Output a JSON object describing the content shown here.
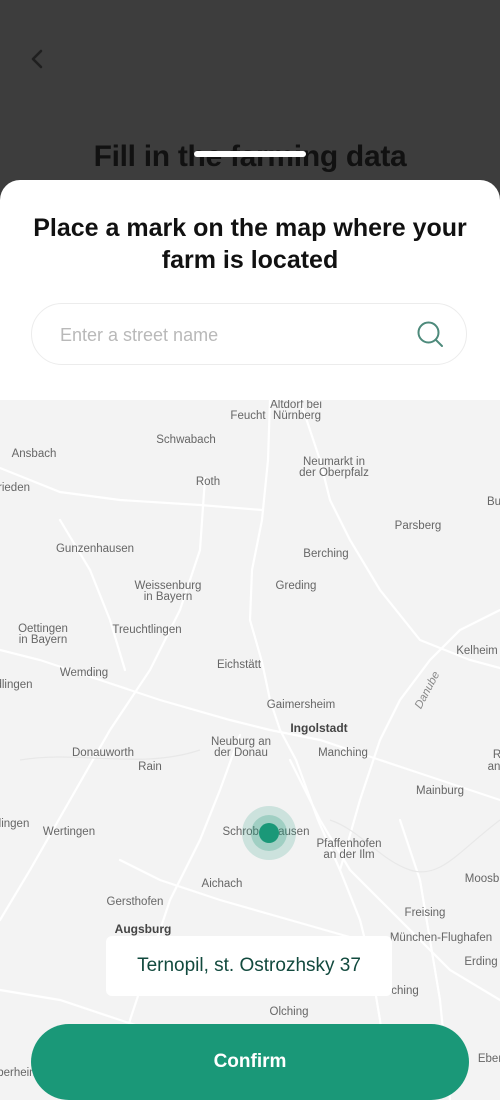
{
  "background": {
    "title": "Fill in the farming data"
  },
  "sheet": {
    "title": "Place a mark on the map where your farm is located",
    "search": {
      "placeholder": "Enter a street name",
      "value": ""
    }
  },
  "map": {
    "places": [
      {
        "id": "altdorf",
        "name": "Altdorf bei"
      },
      {
        "id": "nurnberg",
        "name": "Nürnberg"
      },
      {
        "id": "feucht",
        "name": "Feucht"
      },
      {
        "id": "schwabach",
        "name": "Schwabach"
      },
      {
        "id": "ansbach",
        "name": "Ansbach"
      },
      {
        "id": "neumarkt1",
        "name": "Neumarkt in"
      },
      {
        "id": "neumarkt2",
        "name": "der Oberpfalz"
      },
      {
        "id": "rieden",
        "name": "rieden"
      },
      {
        "id": "roth",
        "name": "Roth"
      },
      {
        "id": "bu",
        "name": "Bu"
      },
      {
        "id": "parsberg",
        "name": "Parsberg"
      },
      {
        "id": "gunzenhausen",
        "name": "Gunzenhausen"
      },
      {
        "id": "berching",
        "name": "Berching"
      },
      {
        "id": "weissenburg1",
        "name": "Weissenburg"
      },
      {
        "id": "weissenburg2",
        "name": "in Bayern"
      },
      {
        "id": "greding",
        "name": "Greding"
      },
      {
        "id": "oettingen1",
        "name": "Oettingen"
      },
      {
        "id": "oettingen2",
        "name": "in Bayern"
      },
      {
        "id": "treuchtlingen",
        "name": "Treuchtlingen"
      },
      {
        "id": "kelheim",
        "name": "Kelheim"
      },
      {
        "id": "eichstatt",
        "name": "Eichstätt"
      },
      {
        "id": "wemding",
        "name": "Wemding"
      },
      {
        "id": "dlingen",
        "name": "dlingen"
      },
      {
        "id": "danube",
        "name": "Danube"
      },
      {
        "id": "gaimersheim",
        "name": "Gaimersheim"
      },
      {
        "id": "ingolstadt",
        "name": "Ingolstadt"
      },
      {
        "id": "neuburg1",
        "name": "Neuburg an"
      },
      {
        "id": "neuburg2",
        "name": "der Donau"
      },
      {
        "id": "donauworth",
        "name": "Donauworth"
      },
      {
        "id": "manching",
        "name": "Manching"
      },
      {
        "id": "rain",
        "name": "Rain"
      },
      {
        "id": "r",
        "name": "R"
      },
      {
        "id": "an",
        "name": "an"
      },
      {
        "id": "mainburg",
        "name": "Mainburg"
      },
      {
        "id": "lingen",
        "name": "lingen"
      },
      {
        "id": "wertingen",
        "name": "Wertingen"
      },
      {
        "id": "schrobenhausen",
        "name": "Schrobenhausen"
      },
      {
        "id": "pfaffenhofen1",
        "name": "Pfaffenhofen"
      },
      {
        "id": "pfaffenhofen2",
        "name": "an der Ilm"
      },
      {
        "id": "aichach",
        "name": "Aichach"
      },
      {
        "id": "moosb",
        "name": "Moosb"
      },
      {
        "id": "gersthofen",
        "name": "Gersthofen"
      },
      {
        "id": "freising",
        "name": "Freising"
      },
      {
        "id": "augsburg",
        "name": "Augsburg"
      },
      {
        "id": "munchen",
        "name": "München-Flughafen"
      },
      {
        "id": "erding",
        "name": "Erding"
      },
      {
        "id": "ching",
        "name": "ching"
      },
      {
        "id": "olching",
        "name": "Olching"
      },
      {
        "id": "berheim",
        "name": "berheim"
      },
      {
        "id": "eber",
        "name": "Eber"
      }
    ]
  },
  "address_label": "Ternopil, st. Ostrozhsky 37",
  "confirm_label": "Confirm",
  "colors": {
    "accent": "#1a9878",
    "backdrop": "#3d3d3d",
    "map_background": "#f3f3f3"
  },
  "icons": {
    "back": "chevron-left-icon",
    "search": "search-icon",
    "marker": "location-marker-icon"
  }
}
